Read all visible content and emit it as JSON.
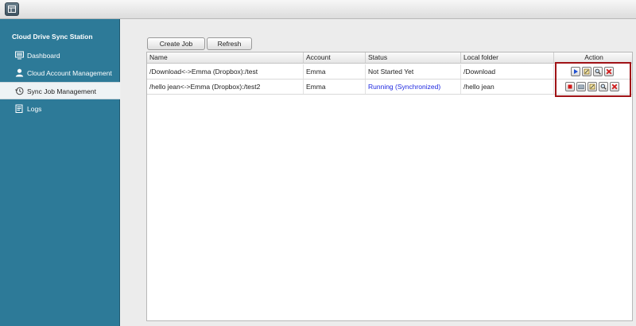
{
  "sidebar": {
    "title": "Cloud Drive Sync Station",
    "items": [
      {
        "label": "Dashboard",
        "icon": "monitor-icon"
      },
      {
        "label": "Cloud Account Management",
        "icon": "user-icon"
      },
      {
        "label": "Sync Job Management",
        "icon": "history-icon",
        "active": true
      },
      {
        "label": "Logs",
        "icon": "logs-icon"
      }
    ]
  },
  "toolbar": {
    "create_label": "Create Job",
    "refresh_label": "Refresh"
  },
  "table": {
    "columns": [
      "Name",
      "Account",
      "Status",
      "Local folder",
      "Action"
    ],
    "rows": [
      {
        "name": "/Download<->Emma (Dropbox):/test",
        "account": "Emma",
        "status": "Not Started Yet",
        "local": "/Download",
        "actions": [
          "play-icon",
          "edit-icon",
          "search-icon",
          "delete-icon"
        ]
      },
      {
        "name": "/hello jean<->Emma (Dropbox):/test2",
        "account": "Emma",
        "status": "Running (Synchronized)",
        "local": "/hello jean",
        "actions": [
          "stop-icon",
          "drive-icon",
          "edit-icon",
          "search-icon",
          "delete-icon"
        ]
      }
    ]
  },
  "colors": {
    "sidebar_bg": "#2d7a98",
    "running_status": "#1f29e0",
    "highlight_border": "#a01317"
  }
}
